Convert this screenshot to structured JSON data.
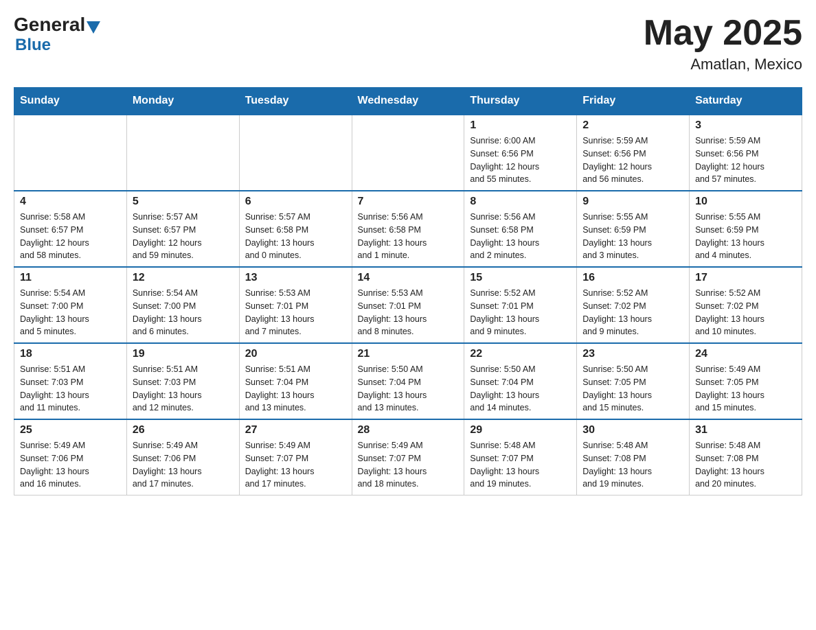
{
  "header": {
    "logo": {
      "general": "General",
      "blue": "Blue"
    },
    "title": "May 2025",
    "location": "Amatlan, Mexico"
  },
  "days_of_week": [
    "Sunday",
    "Monday",
    "Tuesday",
    "Wednesday",
    "Thursday",
    "Friday",
    "Saturday"
  ],
  "weeks": [
    [
      {
        "day": "",
        "info": ""
      },
      {
        "day": "",
        "info": ""
      },
      {
        "day": "",
        "info": ""
      },
      {
        "day": "",
        "info": ""
      },
      {
        "day": "1",
        "info": "Sunrise: 6:00 AM\nSunset: 6:56 PM\nDaylight: 12 hours\nand 55 minutes."
      },
      {
        "day": "2",
        "info": "Sunrise: 5:59 AM\nSunset: 6:56 PM\nDaylight: 12 hours\nand 56 minutes."
      },
      {
        "day": "3",
        "info": "Sunrise: 5:59 AM\nSunset: 6:56 PM\nDaylight: 12 hours\nand 57 minutes."
      }
    ],
    [
      {
        "day": "4",
        "info": "Sunrise: 5:58 AM\nSunset: 6:57 PM\nDaylight: 12 hours\nand 58 minutes."
      },
      {
        "day": "5",
        "info": "Sunrise: 5:57 AM\nSunset: 6:57 PM\nDaylight: 12 hours\nand 59 minutes."
      },
      {
        "day": "6",
        "info": "Sunrise: 5:57 AM\nSunset: 6:58 PM\nDaylight: 13 hours\nand 0 minutes."
      },
      {
        "day": "7",
        "info": "Sunrise: 5:56 AM\nSunset: 6:58 PM\nDaylight: 13 hours\nand 1 minute."
      },
      {
        "day": "8",
        "info": "Sunrise: 5:56 AM\nSunset: 6:58 PM\nDaylight: 13 hours\nand 2 minutes."
      },
      {
        "day": "9",
        "info": "Sunrise: 5:55 AM\nSunset: 6:59 PM\nDaylight: 13 hours\nand 3 minutes."
      },
      {
        "day": "10",
        "info": "Sunrise: 5:55 AM\nSunset: 6:59 PM\nDaylight: 13 hours\nand 4 minutes."
      }
    ],
    [
      {
        "day": "11",
        "info": "Sunrise: 5:54 AM\nSunset: 7:00 PM\nDaylight: 13 hours\nand 5 minutes."
      },
      {
        "day": "12",
        "info": "Sunrise: 5:54 AM\nSunset: 7:00 PM\nDaylight: 13 hours\nand 6 minutes."
      },
      {
        "day": "13",
        "info": "Sunrise: 5:53 AM\nSunset: 7:01 PM\nDaylight: 13 hours\nand 7 minutes."
      },
      {
        "day": "14",
        "info": "Sunrise: 5:53 AM\nSunset: 7:01 PM\nDaylight: 13 hours\nand 8 minutes."
      },
      {
        "day": "15",
        "info": "Sunrise: 5:52 AM\nSunset: 7:01 PM\nDaylight: 13 hours\nand 9 minutes."
      },
      {
        "day": "16",
        "info": "Sunrise: 5:52 AM\nSunset: 7:02 PM\nDaylight: 13 hours\nand 9 minutes."
      },
      {
        "day": "17",
        "info": "Sunrise: 5:52 AM\nSunset: 7:02 PM\nDaylight: 13 hours\nand 10 minutes."
      }
    ],
    [
      {
        "day": "18",
        "info": "Sunrise: 5:51 AM\nSunset: 7:03 PM\nDaylight: 13 hours\nand 11 minutes."
      },
      {
        "day": "19",
        "info": "Sunrise: 5:51 AM\nSunset: 7:03 PM\nDaylight: 13 hours\nand 12 minutes."
      },
      {
        "day": "20",
        "info": "Sunrise: 5:51 AM\nSunset: 7:04 PM\nDaylight: 13 hours\nand 13 minutes."
      },
      {
        "day": "21",
        "info": "Sunrise: 5:50 AM\nSunset: 7:04 PM\nDaylight: 13 hours\nand 13 minutes."
      },
      {
        "day": "22",
        "info": "Sunrise: 5:50 AM\nSunset: 7:04 PM\nDaylight: 13 hours\nand 14 minutes."
      },
      {
        "day": "23",
        "info": "Sunrise: 5:50 AM\nSunset: 7:05 PM\nDaylight: 13 hours\nand 15 minutes."
      },
      {
        "day": "24",
        "info": "Sunrise: 5:49 AM\nSunset: 7:05 PM\nDaylight: 13 hours\nand 15 minutes."
      }
    ],
    [
      {
        "day": "25",
        "info": "Sunrise: 5:49 AM\nSunset: 7:06 PM\nDaylight: 13 hours\nand 16 minutes."
      },
      {
        "day": "26",
        "info": "Sunrise: 5:49 AM\nSunset: 7:06 PM\nDaylight: 13 hours\nand 17 minutes."
      },
      {
        "day": "27",
        "info": "Sunrise: 5:49 AM\nSunset: 7:07 PM\nDaylight: 13 hours\nand 17 minutes."
      },
      {
        "day": "28",
        "info": "Sunrise: 5:49 AM\nSunset: 7:07 PM\nDaylight: 13 hours\nand 18 minutes."
      },
      {
        "day": "29",
        "info": "Sunrise: 5:48 AM\nSunset: 7:07 PM\nDaylight: 13 hours\nand 19 minutes."
      },
      {
        "day": "30",
        "info": "Sunrise: 5:48 AM\nSunset: 7:08 PM\nDaylight: 13 hours\nand 19 minutes."
      },
      {
        "day": "31",
        "info": "Sunrise: 5:48 AM\nSunset: 7:08 PM\nDaylight: 13 hours\nand 20 minutes."
      }
    ]
  ]
}
